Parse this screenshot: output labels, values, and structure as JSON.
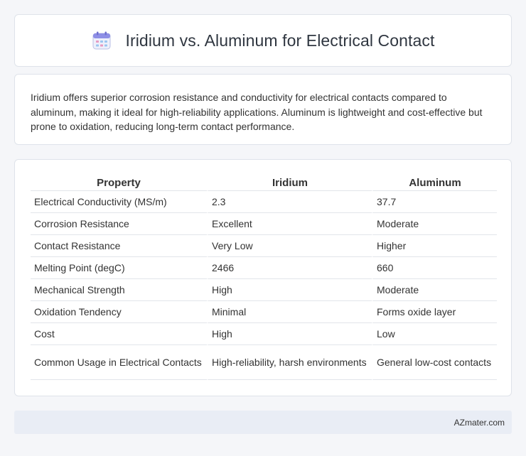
{
  "header": {
    "icon": "calendar-icon",
    "title": "Iridium vs. Aluminum for Electrical Contact"
  },
  "summary": {
    "text": "Iridium offers superior corrosion resistance and conductivity for electrical contacts compared to aluminum, making it ideal for high-reliability applications. Aluminum is lightweight and cost-effective but prone to oxidation, reducing long-term contact performance."
  },
  "table": {
    "headers": [
      "Property",
      "Iridium",
      "Aluminum"
    ],
    "rows": [
      [
        "Electrical Conductivity (MS/m)",
        "2.3",
        "37.7"
      ],
      [
        "Corrosion Resistance",
        "Excellent",
        "Moderate"
      ],
      [
        "Contact Resistance",
        "Very Low",
        "Higher"
      ],
      [
        "Melting Point (degC)",
        "2466",
        "660"
      ],
      [
        "Mechanical Strength",
        "High",
        "Moderate"
      ],
      [
        "Oxidation Tendency",
        "Minimal",
        "Forms oxide layer"
      ],
      [
        "Cost",
        "High",
        "Low"
      ],
      [
        "Common Usage in Electrical Contacts",
        "High-reliability, harsh environments",
        "General low-cost contacts"
      ]
    ]
  },
  "footer": {
    "text": "AZmater.com"
  }
}
